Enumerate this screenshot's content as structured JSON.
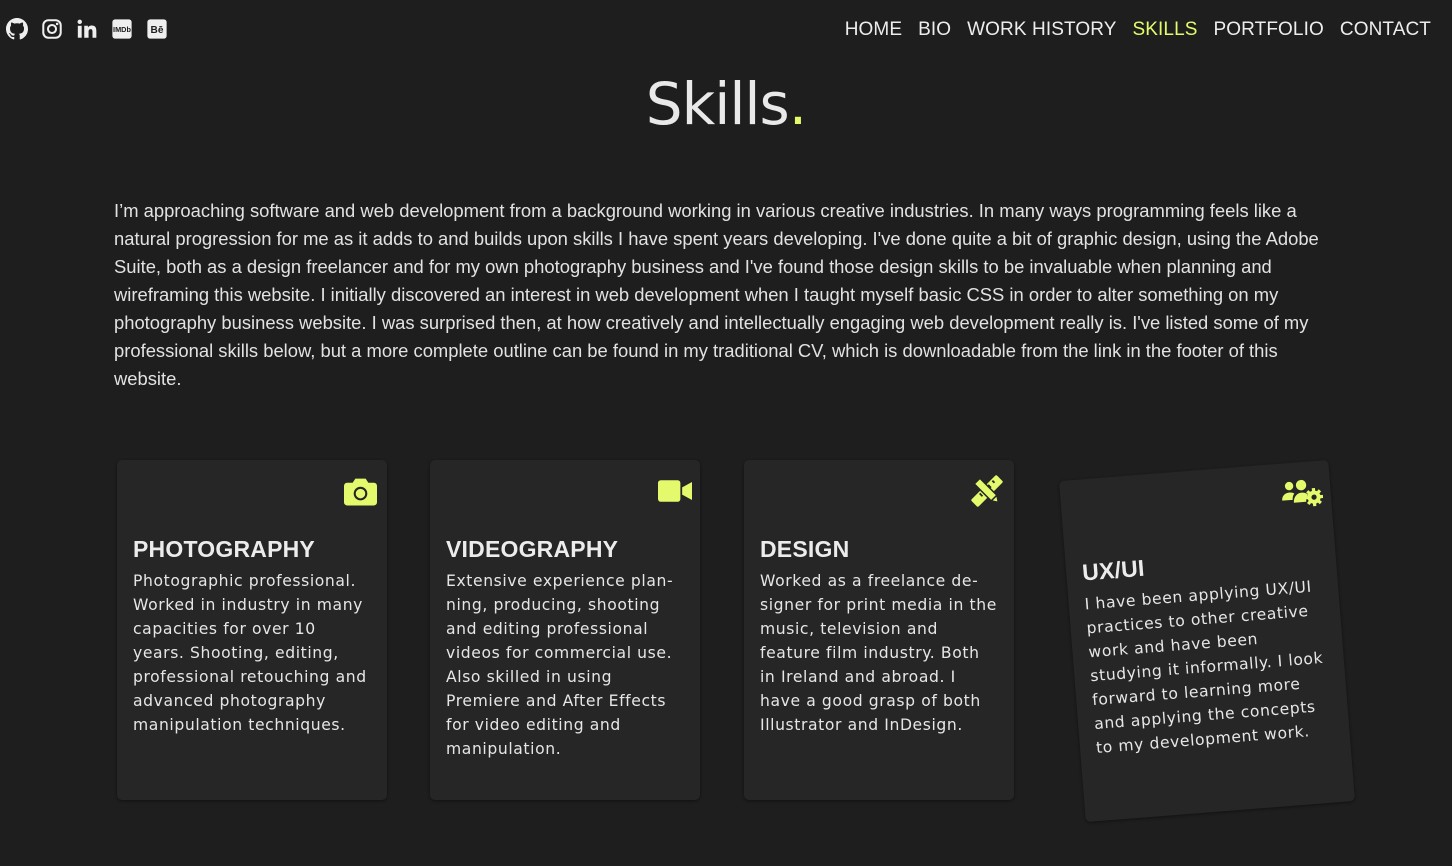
{
  "social": [
    {
      "name": "github-icon",
      "label": "GitHub"
    },
    {
      "name": "instagram-icon",
      "label": "Instagram"
    },
    {
      "name": "linkedin-icon",
      "label": "LinkedIn"
    },
    {
      "name": "imdb-icon",
      "label": "IMDb"
    },
    {
      "name": "behance-icon",
      "label": "Behance"
    }
  ],
  "nav": {
    "items": [
      {
        "label": "HOME",
        "active": false
      },
      {
        "label": "BIO",
        "active": false
      },
      {
        "label": "WORK HISTORY",
        "active": false
      },
      {
        "label": "SKILLS",
        "active": true
      },
      {
        "label": "PORTFOLIO",
        "active": false
      },
      {
        "label": "CONTACT",
        "active": false
      }
    ]
  },
  "page": {
    "title": "Skills",
    "title_dot": ".",
    "intro": "I’m approaching software and web development from a background working in various creative industries. In many ways programming feels like a natural progression for me as it adds to and builds upon skills I have spent years developing. I've done quite a bit of graphic design, using the Adobe Suite, both as a design freelancer and for my own photography business and I've found those design skills to be invaluable when planning and wireframing this website. I initially discovered an interest in web development when I taught myself basic CSS in order to alter something on my photography business website. I was surprised then, at how creatively and intellectually engaging web development really is. I've listed some of my professional skills below, but a more complete outline can be found in my traditional CV, which is downloadable from the link in the footer of this website."
  },
  "cards": [
    {
      "icon": "camera-icon",
      "title": "PHOTOGRAPHY",
      "text": "Photographic professional. Worked in industry in many capacities for over 10 years. Shooting, editing, profes­sional retouching and ad­vanced photography manipu­lation techniques."
    },
    {
      "icon": "video-camera-icon",
      "title": "VIDEOGRAPHY",
      "text": "Extensive experience plan­ning, producing, shooting and editing professional videos for commercial use. Also skilled in using Premiere and After Effects for video editing and manipulation."
    },
    {
      "icon": "pencil-ruler-icon",
      "title": "DESIGN",
      "text": "Worked as a freelance de­signer for print media in the music, television and feature film industry. Both in Ireland and abroad. I have a good grasp of both Illustrator and InDesign."
    },
    {
      "icon": "users-cog-icon",
      "title": "UX/UI",
      "text": "I have been applying UX/UI practices to other creative work and have been studying it informally. I look forward to learning more and applying the concepts to my develop­ment work."
    }
  ],
  "colors": {
    "background": "#1e1e1e",
    "card": "#262626",
    "accent": "#e4fa6c",
    "text": "#e8e8e8"
  }
}
